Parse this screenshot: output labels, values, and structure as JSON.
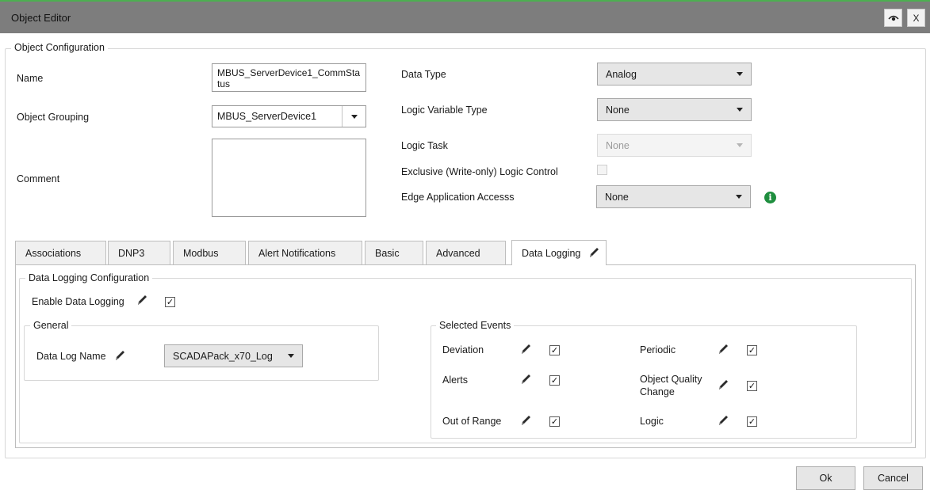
{
  "window": {
    "title": "Object Editor",
    "eye_button_icon": "eye-icon",
    "close_label": "X"
  },
  "object_config": {
    "legend": "Object Configuration",
    "name_label": "Name",
    "name_value": "MBUS_ServerDevice1_CommStatus",
    "grouping_label": "Object Grouping",
    "grouping_value": "MBUS_ServerDevice1",
    "comment_label": "Comment",
    "comment_value": "",
    "data_type_label": "Data Type",
    "data_type_value": "Analog",
    "logic_var_type_label": "Logic Variable Type",
    "logic_var_type_value": "None",
    "logic_task_label": "Logic Task",
    "logic_task_value": "None",
    "exclusive_label": "Exclusive (Write-only) Logic Control",
    "exclusive_checked": false,
    "edge_access_label": "Edge Application Accesss",
    "edge_access_value": "None",
    "info_icon": "info-icon",
    "info_glyph": "i"
  },
  "tabs": [
    {
      "label": "Associations",
      "active": false
    },
    {
      "label": "DNP3",
      "active": false
    },
    {
      "label": "Modbus",
      "active": false
    },
    {
      "label": "Alert Notifications",
      "active": false
    },
    {
      "label": "Basic",
      "active": false
    },
    {
      "label": "Advanced",
      "active": false
    },
    {
      "label": "Data Logging",
      "active": true
    }
  ],
  "data_logging": {
    "legend": "Data Logging Configuration",
    "enable_label": "Enable Data Logging",
    "enable_checked": true,
    "general": {
      "legend": "General",
      "log_name_label": "Data Log Name",
      "log_name_value": "SCADAPack_x70_Log"
    },
    "selected_events": {
      "legend": "Selected Events",
      "deviation_label": "Deviation",
      "deviation_checked": true,
      "alerts_label": "Alerts",
      "alerts_checked": true,
      "out_of_range_label": "Out of Range",
      "out_of_range_checked": true,
      "periodic_label": "Periodic",
      "periodic_checked": true,
      "quality_label_line1": "Object Quality",
      "quality_label_line2": "Change",
      "quality_checked": true,
      "logic_label": "Logic",
      "logic_checked": true
    }
  },
  "footer": {
    "ok_label": "Ok",
    "cancel_label": "Cancel"
  },
  "glyphs": {
    "check": "✓"
  }
}
